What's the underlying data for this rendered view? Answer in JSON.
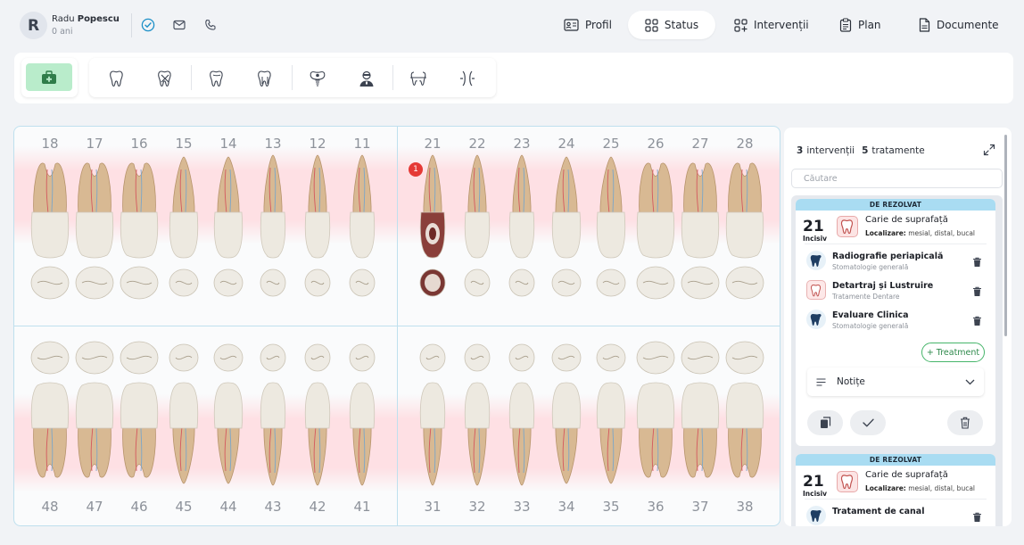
{
  "patient": {
    "initial": "R",
    "first_name": "Radu",
    "last_name": "Popescu",
    "age": "0 ani"
  },
  "nav": {
    "tabs": [
      {
        "label": "Profil",
        "icon": "id-card-icon"
      },
      {
        "label": "Status",
        "icon": "grid-icon",
        "active": true
      },
      {
        "label": "Intervenții",
        "icon": "add-grid-icon"
      },
      {
        "label": "Plan",
        "icon": "clipboard-icon"
      },
      {
        "label": "Documente",
        "icon": "document-icon"
      }
    ]
  },
  "header_icons": [
    "verified-check-icon",
    "mail-icon",
    "phone-icon"
  ],
  "toolbar": {
    "active_tool": "medical-kit-icon",
    "tools": [
      "tooth-icon",
      "tooth-extraction-icon",
      "tooth-icon",
      "tooth-roots-icon",
      "implant-icon",
      "dentist-icon",
      "orthodontic-icon",
      "bracket-icon"
    ]
  },
  "colors": {
    "accent_green": "#b9eccb",
    "status_blue": "#a9dcf2",
    "badge_red": "#e53935",
    "band_pink": "#ffd7dc"
  },
  "chart": {
    "upper_numbers": [
      "18",
      "17",
      "16",
      "15",
      "14",
      "13",
      "12",
      "11",
      "21",
      "22",
      "23",
      "24",
      "25",
      "26",
      "27",
      "28"
    ],
    "lower_numbers": [
      "48",
      "47",
      "46",
      "45",
      "44",
      "43",
      "42",
      "41",
      "31",
      "32",
      "33",
      "34",
      "35",
      "36",
      "37",
      "38"
    ],
    "badge": {
      "tooth": "21",
      "count": "1"
    }
  },
  "panel": {
    "interventions_count": "3",
    "interventions_label": "intervenții",
    "treatments_count": "5",
    "treatments_label": "tratamente",
    "search_placeholder": "Căutare",
    "cards": [
      {
        "status": "DE REZOLVAT",
        "tooth_number": "21",
        "tooth_label": "Incisiv",
        "diagnosis": "Carie de suprafață",
        "location_label": "Localizare:",
        "location_value": "mesial, distal, bucal",
        "treatments": [
          {
            "name": "Radiografie periapicală",
            "category": "Stomatologie generală",
            "icon": "xray-tooth-icon"
          },
          {
            "name": "Detartraj și Lustruire",
            "category": "Tratamente Dentare",
            "icon": "tooth-clean-icon"
          },
          {
            "name": "Evaluare Clinica",
            "category": "Stomatologie generală",
            "icon": "xray-tooth-icon"
          }
        ],
        "add_treatment_label": "+ Treatment",
        "notes_label": "Notițe"
      },
      {
        "status": "DE REZOLVAT",
        "tooth_number": "21",
        "tooth_label": "Incisiv",
        "diagnosis": "Carie de suprafață",
        "location_label": "Localizare:",
        "location_value": "mesial, distal, bucal",
        "treatments": [
          {
            "name": "Tratament de canal",
            "category": "",
            "icon": "xray-tooth-icon"
          }
        ]
      }
    ]
  }
}
